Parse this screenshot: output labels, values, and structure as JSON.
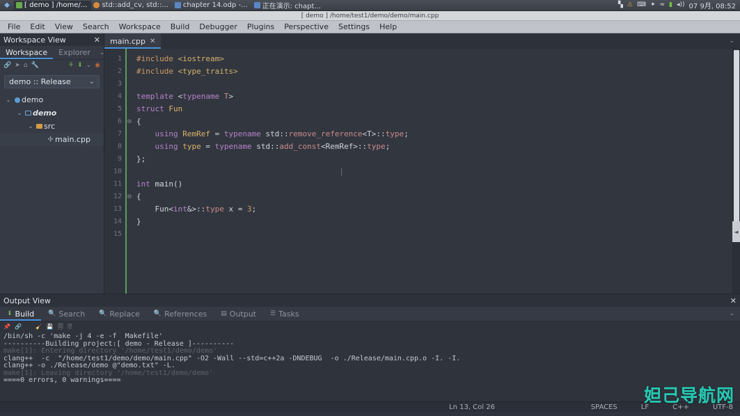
{
  "taskbar": {
    "start_icon": "start-menu-icon",
    "tasks": [
      {
        "label": "[ demo ] /home/...",
        "icon": "green",
        "active": true
      },
      {
        "label": "std::add_cv, std::...",
        "icon": "orange",
        "active": false
      },
      {
        "label": "chapter 14.odp -...",
        "icon": "blue",
        "active": false
      },
      {
        "label": "正在演示: chapt...",
        "icon": "blue",
        "active": false
      }
    ],
    "tray": {
      "icons": [
        "network-icon",
        "warning-icon",
        "keyboard-icon",
        "bluetooth-icon",
        "wifi-icon",
        "battery-icon",
        "volume-icon"
      ],
      "clock": "07 9月, 08:52"
    }
  },
  "titlebar": {
    "title": "[ demo ] /home/test1/demo/demo/main.cpp"
  },
  "menubar": {
    "items": [
      "File",
      "Edit",
      "View",
      "Search",
      "Workspace",
      "Build",
      "Debugger",
      "Plugins",
      "Perspective",
      "Settings",
      "Help"
    ]
  },
  "workspace_view": {
    "title": "Workspace View",
    "close_label": "✕",
    "tabs": [
      {
        "label": "Workspace",
        "active": true
      },
      {
        "label": "Explorer",
        "active": false
      }
    ],
    "tabs_chevron": "⌄",
    "toolbar_icons": [
      "link-icon",
      "send-icon",
      "home-icon",
      "wrench-icon",
      "run-icon",
      "build-icon",
      "chevron-down-icon",
      "stop-icon"
    ],
    "project_select": {
      "value": "demo :: Release",
      "chevron": "⌄"
    },
    "tree": [
      {
        "twisty": "⌄",
        "icon": "project-icon",
        "label": "demo",
        "indent": 0,
        "italic": false,
        "selected": false
      },
      {
        "twisty": "⌄",
        "icon": "folder-blue-icon",
        "label": "demo",
        "indent": 1,
        "italic": true,
        "selected": false
      },
      {
        "twisty": "⌄",
        "icon": "folder-orange-icon",
        "label": "src",
        "indent": 2,
        "italic": false,
        "selected": false
      },
      {
        "twisty": "",
        "icon": "cpp-file-icon",
        "label": "main.cpp",
        "indent": 3,
        "italic": false,
        "selected": true
      }
    ]
  },
  "editor": {
    "tab": {
      "label": "main.cpp",
      "close": "✕"
    },
    "tabs_chevron": "⌄",
    "line_numbers": [
      "1",
      "2",
      "3",
      "4",
      "5",
      "6",
      "7",
      "8",
      "9",
      "10",
      "11",
      "12",
      "13",
      "14",
      "15"
    ],
    "fold_markers": [
      "",
      "",
      "",
      "",
      "",
      "⊟",
      "",
      "",
      "",
      "",
      "",
      "⊟",
      "",
      "",
      ""
    ],
    "code_lines": [
      [
        {
          "t": "#include ",
          "c": "tok-pre"
        },
        {
          "t": "<iostream>",
          "c": "tok-str"
        }
      ],
      [
        {
          "t": "#include ",
          "c": "tok-pre"
        },
        {
          "t": "<type_traits>",
          "c": "tok-str"
        }
      ],
      [],
      [
        {
          "t": "template ",
          "c": "tok-kw"
        },
        {
          "t": "<",
          "c": "tok-plain"
        },
        {
          "t": "typename",
          "c": "tok-kw"
        },
        {
          "t": " ",
          "c": "tok-plain"
        },
        {
          "t": "T",
          "c": "tok-type"
        },
        {
          "t": ">",
          "c": "tok-plain"
        }
      ],
      [
        {
          "t": "struct ",
          "c": "tok-kw"
        },
        {
          "t": "Fun",
          "c": "tok-id"
        }
      ],
      [
        {
          "t": "{",
          "c": "tok-plain"
        }
      ],
      [
        {
          "t": "    using ",
          "c": "tok-kw"
        },
        {
          "t": "RemRef",
          "c": "tok-id"
        },
        {
          "t": " = ",
          "c": "tok-plain"
        },
        {
          "t": "typename",
          "c": "tok-kw"
        },
        {
          "t": " std::",
          "c": "tok-plain"
        },
        {
          "t": "remove_reference",
          "c": "tok-type"
        },
        {
          "t": "<T>::",
          "c": "tok-plain"
        },
        {
          "t": "type",
          "c": "tok-type"
        },
        {
          "t": ";",
          "c": "tok-plain"
        }
      ],
      [
        {
          "t": "    using ",
          "c": "tok-kw"
        },
        {
          "t": "type",
          "c": "tok-id"
        },
        {
          "t": " = ",
          "c": "tok-plain"
        },
        {
          "t": "typename",
          "c": "tok-kw"
        },
        {
          "t": " std::",
          "c": "tok-plain"
        },
        {
          "t": "add_const",
          "c": "tok-type"
        },
        {
          "t": "<RemRef>::",
          "c": "tok-plain"
        },
        {
          "t": "type",
          "c": "tok-type"
        },
        {
          "t": ";",
          "c": "tok-plain"
        }
      ],
      [
        {
          "t": "};",
          "c": "tok-plain"
        }
      ],
      [
        {
          "t": "                                            |",
          "c": "caret-mark"
        }
      ],
      [
        {
          "t": "int ",
          "c": "tok-kw"
        },
        {
          "t": "main",
          "c": "tok-fn"
        },
        {
          "t": "()",
          "c": "tok-plain"
        }
      ],
      [
        {
          "t": "{",
          "c": "tok-plain"
        }
      ],
      [
        {
          "t": "    Fun<",
          "c": "tok-plain"
        },
        {
          "t": "int",
          "c": "tok-kw"
        },
        {
          "t": "&>::",
          "c": "tok-plain"
        },
        {
          "t": "type",
          "c": "tok-type"
        },
        {
          "t": " x = ",
          "c": "tok-plain"
        },
        {
          "t": "3",
          "c": "tok-num"
        },
        {
          "t": ";",
          "c": "tok-plain"
        }
      ],
      [
        {
          "t": "}",
          "c": "tok-plain"
        }
      ],
      []
    ],
    "collapse_handle": "◄"
  },
  "output_view": {
    "title": "Output View",
    "close_label": "✕",
    "tabs": [
      {
        "label": "Build",
        "icon": "build-icon",
        "active": true
      },
      {
        "label": "Search",
        "icon": "search-icon",
        "active": false
      },
      {
        "label": "Replace",
        "icon": "replace-icon",
        "active": false
      },
      {
        "label": "References",
        "icon": "references-icon",
        "active": false
      },
      {
        "label": "Output",
        "icon": "output-icon",
        "active": false
      },
      {
        "label": "Tasks",
        "icon": "tasks-icon",
        "active": false
      }
    ],
    "tabs_chevron": "⌄",
    "toolbar_icons": [
      "pin-icon",
      "link-icon",
      "clear-icon",
      "save-icon",
      "copy-icon",
      "copy-all-icon"
    ],
    "build_log": [
      {
        "text": "/bin/sh -c 'make -j 4 -e -f  Makefile'",
        "c": "log-normal"
      },
      {
        "text": "----------Building project:[ demo - Release ]----------",
        "c": "log-normal"
      },
      {
        "text": "make[1]: Entering directory '/home/test1/demo/demo'",
        "c": "log-dim"
      },
      {
        "text": "clang++  -c  \"/home/test1/demo/demo/main.cpp\" -O2 -Wall --std=c++2a -DNDEBUG  -o ./Release/main.cpp.o -I. -I.",
        "c": "log-normal"
      },
      {
        "text": "clang++ -o ./Release/demo @\"demo.txt\" -L.",
        "c": "log-normal"
      },
      {
        "text": "make[1]: Leaving directory '/home/test1/demo/demo'",
        "c": "log-dim"
      },
      {
        "text": "====0 errors, 0 warnings====",
        "c": "log-normal"
      }
    ]
  },
  "statusbar": {
    "position": "Ln 13, Col 26",
    "indent": "SPACES",
    "eol": "LF",
    "language": "C++",
    "encoding": "UTF-8"
  },
  "watermark": {
    "text": "妲己导航网",
    "color": "#25d8c0"
  }
}
